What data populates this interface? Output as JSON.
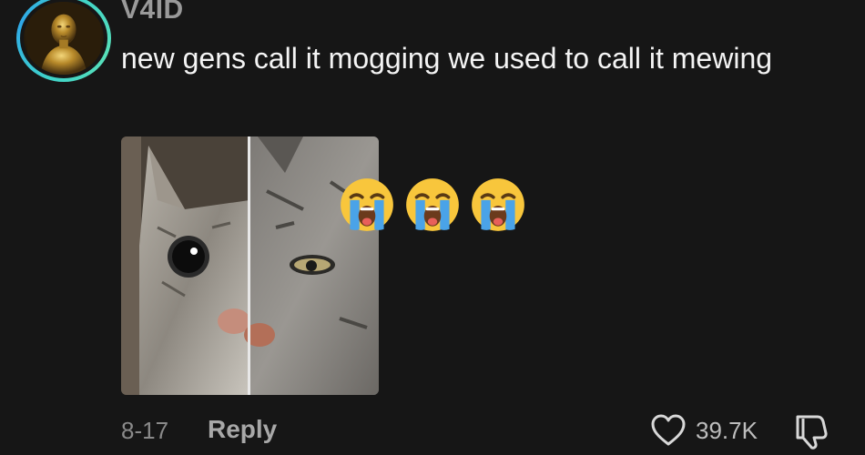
{
  "comment": {
    "username": "V4ID",
    "text": "new gens call it mogging we used to call it mewing",
    "emojis": [
      "loudly-crying-face",
      "loudly-crying-face",
      "loudly-crying-face"
    ],
    "date": "8-17",
    "reply_label": "Reply",
    "like_count": "39.7K"
  },
  "icons": {
    "like": "heart-outline-icon",
    "dislike": "thumbs-down-outline-icon"
  },
  "colors": {
    "background": "#161616",
    "avatar_ring": "#3fd3c9",
    "text": "#f4f4f4",
    "muted": "#8a8a8a"
  }
}
